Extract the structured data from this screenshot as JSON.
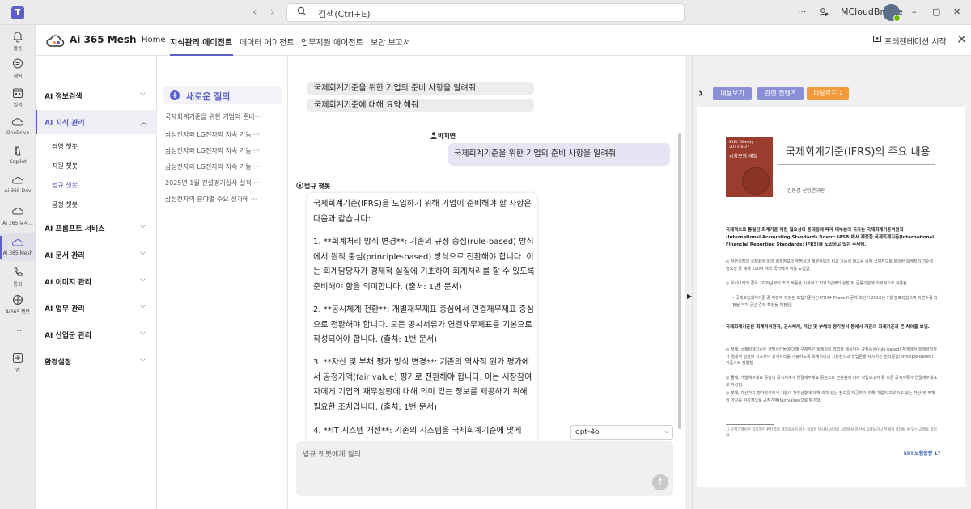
{
  "titlebar": {
    "search_placeholder": "검색(Ctrl+E)",
    "more": "···",
    "user_name": "MCloudBridge",
    "minimize": "–",
    "maximize": "▢",
    "close": "✕"
  },
  "rail": [
    {
      "label": "활동",
      "icon": "bell-icon"
    },
    {
      "label": "채팅",
      "icon": "chat-icon"
    },
    {
      "label": "일정",
      "icon": "calendar-icon"
    },
    {
      "label": "OneDrive",
      "icon": "cloud-icon"
    },
    {
      "label": "Copilot",
      "icon": "copilot-icon"
    },
    {
      "label": "Ai 365 Dev",
      "icon": "app-icon"
    },
    {
      "label": "Ai 365 유지...",
      "icon": "app-icon"
    },
    {
      "label": "Ai 365 Mesh",
      "icon": "app-icon"
    },
    {
      "label": "통화",
      "icon": "phone-icon"
    },
    {
      "label": "Ai365 챗봇",
      "icon": "bot-icon"
    },
    {
      "label": "",
      "icon": "more-icon"
    },
    {
      "label": "앱",
      "icon": "plus-icon"
    }
  ],
  "header": {
    "app_name": "Ai 365 Mesh",
    "tabs": [
      {
        "label": "Home"
      },
      {
        "label": "지식관리 에이전트"
      },
      {
        "label": "데이터 에이전트"
      },
      {
        "label": "업무지원 에이전트"
      },
      {
        "label": "보안 보고서"
      }
    ],
    "present_label": "프레젠테이션 시작",
    "close": "✕"
  },
  "leftnav": {
    "sections": [
      {
        "label": "AI 정보검색",
        "chev": "⌵"
      },
      {
        "label": "AI 지식 관리",
        "chev": "︿"
      },
      {
        "label": "AI 프롬프트 서비스",
        "chev": "⌵"
      },
      {
        "label": "AI 문서 관리",
        "chev": "⌵"
      },
      {
        "label": "AI 이미지 관리",
        "chev": "⌵"
      },
      {
        "label": "AI 업무 관리",
        "chev": "⌵"
      },
      {
        "label": "AI 산업군 관리",
        "chev": "⌵"
      },
      {
        "label": "환경설정",
        "chev": "⌵"
      }
    ],
    "sub_items": [
      "경영 챗봇",
      "지원 챗봇",
      "법규 챗봇",
      "공정 챗봇"
    ]
  },
  "history": {
    "new_chat": "새로운 질의",
    "items": [
      "국제회계기준을 위한 기업의 준비···",
      "삼성전자와 LG전자의 지속 가능 ···",
      "삼성전자와 LG전자의 지속 가능 ···",
      "삼성전자와 LG전자의 지속 가능 ···",
      "2025년 1월 건설경기실사 실적 ···",
      "삼성전자의 분야별 주요 성과에 ···"
    ]
  },
  "chat": {
    "prev_msgs": [
      "국제회계기준을 위한 기업의 준비 사항을 알려줘",
      "국제회계기준에 대해 요약 해줘"
    ],
    "user_name": "박지연",
    "user_msg": "국제회계기준을 위한 기업의 준비 사항을 알려줘",
    "bot_name": "법규 챗봇",
    "bot_paragraphs": [
      "국제회계기준(IFRS)을 도입하기 위해 기업이 준비해야 할 사항은 다음과 같습니다:",
      "1. **회계처리 방식 변경**: 기존의 규정 중심(rule-based) 방식에서 원칙 중심(principle-based) 방식으로 전환해야 합니다. 이는 회계담당자가 경제적 실질에 기초하여 회계처리를 할 수 있도록 준비해야 함을 의미합니다. (출처: 1번 문서)",
      "2. **공시체계 전환**: 개별재무제표 중심에서 연결재무제표 중심으로 전환해야 합니다. 모든 공시서류가 연결재무제표를 기본으로 작성되어야 합니다. (출처: 1번 문서)",
      "3. **자산 및 부채 평가 방식 변경**: 기존의 역사적 원가 평가에서 공정가액(fair value) 평가로 전환해야 합니다. 이는 시장참여자에게 기업의 재무상황에 대해 의미 있는 정보를 제공하기 위해 필요한 조치입니다. (출처: 1번 문서)",
      "4. **IT 시스템 개선**: 기존의 시스템을 국제회계기준에 맞게"
    ],
    "model": "gpt-4o",
    "input_placeholder": "법규 챗봇에게 질의",
    "send": "↑"
  },
  "viewer": {
    "buttons": [
      {
        "label": "내용보기",
        "color": "#8a8fd8"
      },
      {
        "label": "관련 컨텐츠",
        "color": "#8a8fd8"
      },
      {
        "label": "다운로드 ⤓",
        "color": "#f39a3c"
      }
    ],
    "doc": {
      "head_top": "KiBi Weekly 2011.6.27",
      "head_label": "금융보험 해설",
      "title": "국제회계기준(IFRS)의 주요 내용",
      "author": "김동겸 선임연구원",
      "p1": "국제적으로 통일된 회계기준 마련 필요성이 증대됨에 따라 대부분의 국가는 국제회계기준위원회(International Accounting Standards Board: IASB)에서 제정한 국제회계기준(International Financial Reporting Standards: IFRS)을 도입하고 있는 추세임.",
      "p2": "◎ 자본시장의 국제화에 따라 회계정보의 투명성과 재무정보의 비교 가능성 제고를 위해 국제적으로 통일된 회계처리 기준의 필요성 큰 세계 100여 개의 국가에서 이를 도입함.",
      "p3": "◎ 우리나라의 경우 2009년부터 조기 적용을 시작하고 2011년부터 상장 및 금융기관에 의무적으로 적용됨.",
      "p4": "– 국제보험회계기준 중 재정계 개정된 보험기준서인 IFRS4 Phase II 공개 초안이 2010년 7월 발표되었으며 의견수렴 과정을 거쳐 금년 중에 확정될 예정임.",
      "p5": "국제회계기준은 회계처리원칙, 공시체계, 자산 및 부채의 평가방식 등에서 기존의 회계기준과 큰 차이를 보임.",
      "p6": "◎ 첫째, 국제회계기준은 개별사안들에 대해 구체적인 회계처리 방법을 제공하는 규정중심(rule-based) 체계에서 회계담당자가 경제적 실질에 기초하여 회계처리를 가능하도록 회계처리의 기본원칙과 방법론을 제시하는 원칙중심(principle-based) 기준으로 전환함.",
      "p7": "◎ 둘째, 개별재무제표 중심의 공시체계가 연결재무제표 중심으로 전환됨에 따라 사업보고서 등 모든 공시서류가 연결재무제표로 작성됨.",
      "p8": "◎ 셋째, 자산가치 평가방식에서 기업의 재무상황에 대해 의미 있는 정보를 제공하기 위해 기업이 보유하고 있는 자산 및 부채의 가치를 원칙적으로 공정가액(fair value)으로 평가함.",
      "footnote": "1) 공정가액이란 합리적인 판단력과 거래의사가 있는 독립된 당사자 사이의 거래에서 자산이 교환되거나 부채가 결제될 수 있는 금액을 의미함.",
      "page": "kiri 보험동향 17"
    }
  }
}
